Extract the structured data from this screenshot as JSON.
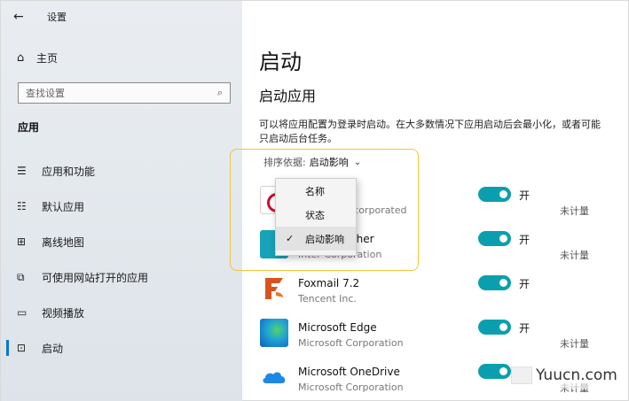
{
  "window": {
    "title": "设置"
  },
  "sidebar": {
    "home_label": "主页",
    "search_placeholder": "查找设置",
    "section_title": "应用",
    "items": [
      {
        "label": "应用和功能",
        "icon": "apps-list-icon"
      },
      {
        "label": "默认应用",
        "icon": "default-apps-icon"
      },
      {
        "label": "离线地图",
        "icon": "offline-maps-icon"
      },
      {
        "label": "可使用网站打开的应用",
        "icon": "website-apps-icon"
      },
      {
        "label": "视频播放",
        "icon": "video-playback-icon"
      },
      {
        "label": "启动",
        "icon": "startup-icon",
        "active": true
      }
    ]
  },
  "main": {
    "title": "启动",
    "subtitle": "启动应用",
    "description": "可以将应用配置为登录时启动。在大多数情况下应用启动后会最小化，或者可能只启动后台任务。",
    "sort_label": "排序依据:",
    "sort_value": "启动影响",
    "apps": [
      {
        "name": "",
        "publisher": "ms Incorporated",
        "toggle": "开",
        "impact": "未计量",
        "icon": "red-circle-app-icon"
      },
      {
        "name": "cher",
        "publisher": "Inter Corporation",
        "toggle": "开",
        "impact": "未计量",
        "icon": "teal-app-icon"
      },
      {
        "name": "Foxmail 7.2",
        "publisher": "Tencent Inc.",
        "toggle": "开",
        "impact": "",
        "icon": "foxmail-icon"
      },
      {
        "name": "Microsoft Edge",
        "publisher": "Microsoft Corporation",
        "toggle": "开",
        "impact": "未计量",
        "icon": "edge-icon"
      },
      {
        "name": "Microsoft OneDrive",
        "publisher": "Microsoft Corporation",
        "toggle": "开",
        "impact": "未计量",
        "icon": "onedrive-icon"
      }
    ]
  },
  "sort_menu": {
    "options": [
      "名称",
      "状态",
      "启动影响"
    ],
    "selected": "启动影响"
  },
  "watermark": {
    "text": "Yuucn.com"
  },
  "colors": {
    "toggle_on": "#0a9fae",
    "highlight": "#f3c33c",
    "accent": "#0078d4"
  }
}
